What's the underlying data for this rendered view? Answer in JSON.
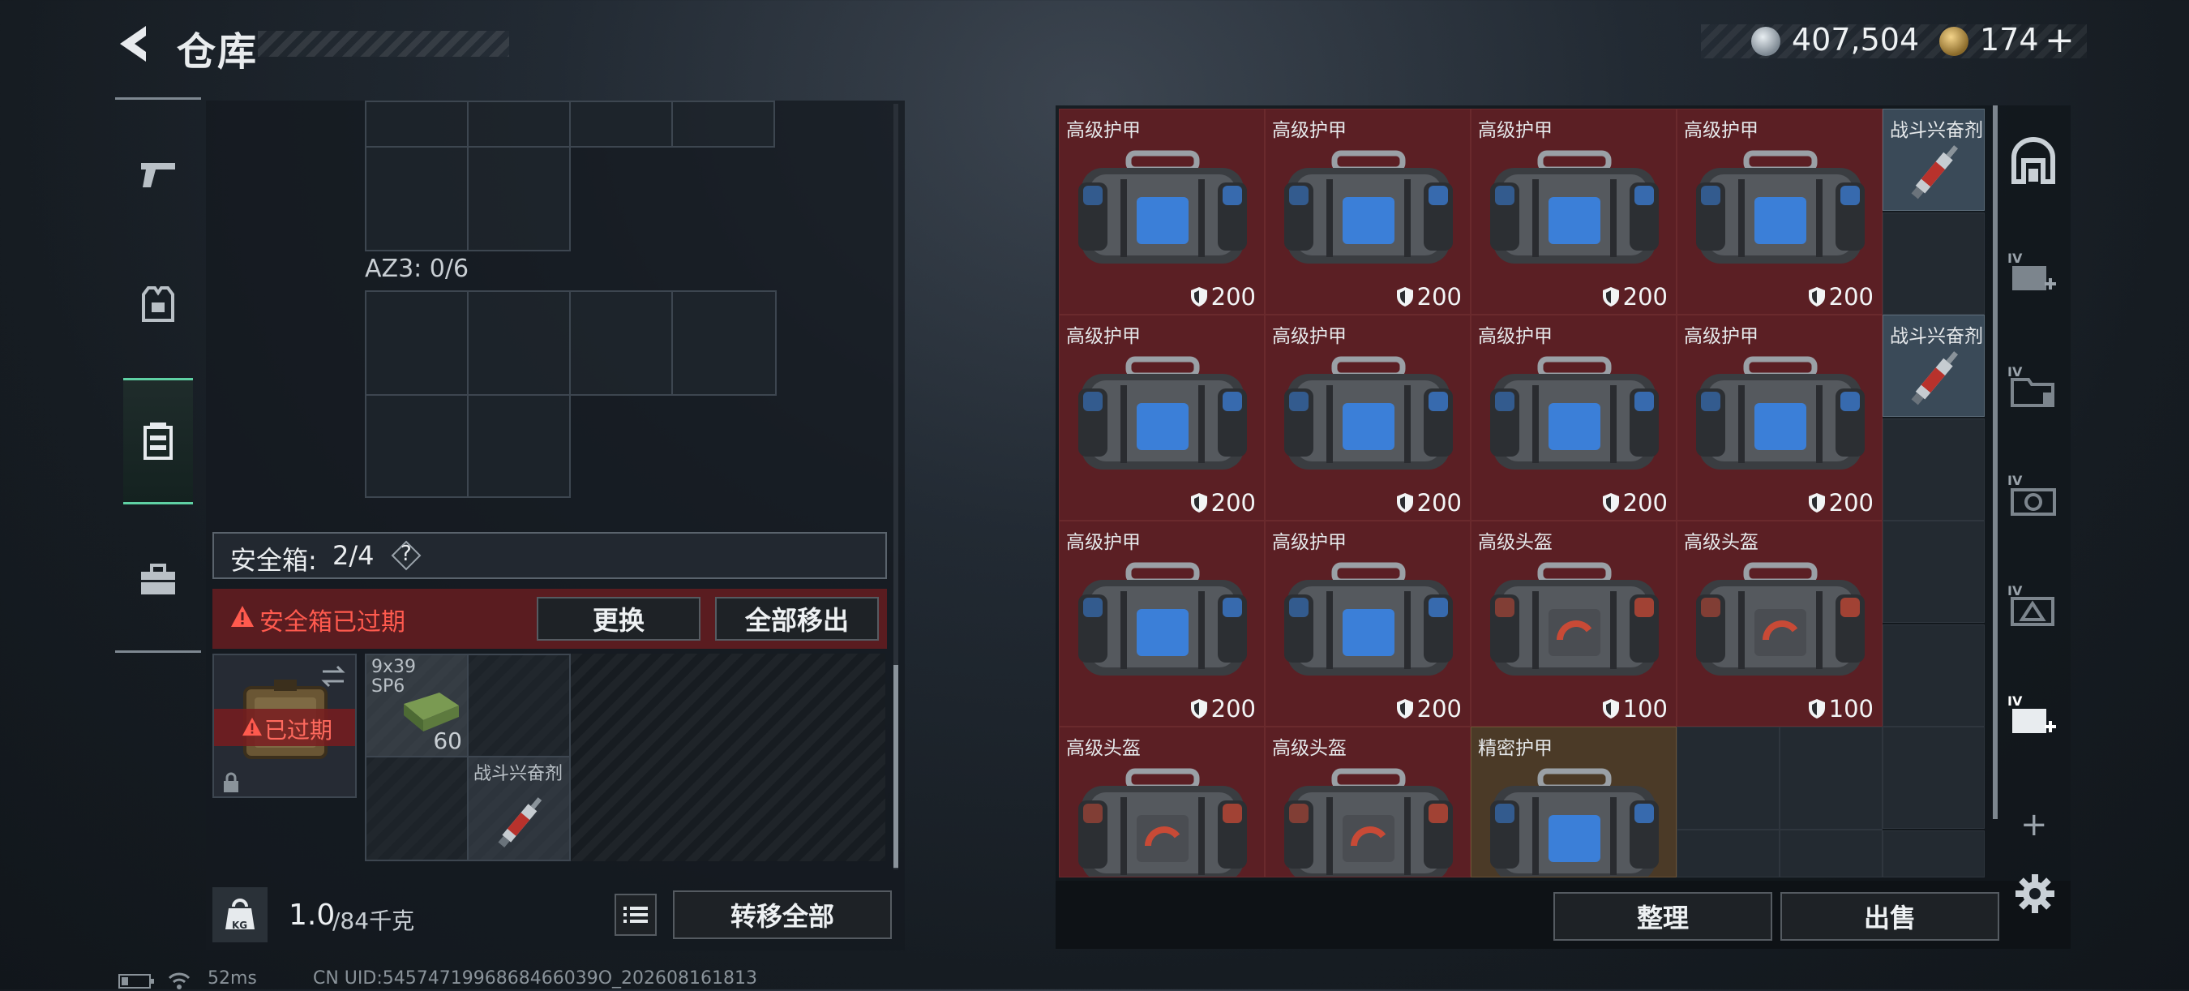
{
  "header": {
    "title": "仓库",
    "currency": {
      "coins": "407,504",
      "tokens": "174",
      "add_label": "+"
    }
  },
  "left_rail": {
    "items": [
      "weapon",
      "equipment",
      "safe-box",
      "case"
    ],
    "active": "safe-box"
  },
  "left_panel": {
    "az_label": "AZ3: 0/6",
    "safe_box": {
      "label": "安全箱:",
      "count": "2/4",
      "help": "?"
    },
    "expired_warning": "安全箱已过期",
    "replace_label": "更换",
    "move_all_out_label": "全部移出",
    "expired_badge": "已过期",
    "ammo": {
      "name": "9x39",
      "sub": "SP6",
      "count": "60"
    },
    "stim_name": "战斗兴奋剂"
  },
  "bottom_left": {
    "weight": "1.0",
    "weight_max": "/84千克",
    "kg_icon_label": "KG",
    "transfer_all_label": "转移全部"
  },
  "inventory": [
    {
      "name": "高级护甲",
      "value": "200",
      "kind": "armor"
    },
    {
      "name": "高级护甲",
      "value": "200",
      "kind": "armor"
    },
    {
      "name": "高级护甲",
      "value": "200",
      "kind": "armor"
    },
    {
      "name": "高级护甲",
      "value": "200",
      "kind": "armor"
    },
    {
      "name": "战斗兴奋剂",
      "value": "",
      "kind": "stim"
    },
    {
      "name": "高级护甲",
      "value": "200",
      "kind": "armor"
    },
    {
      "name": "高级护甲",
      "value": "200",
      "kind": "armor"
    },
    {
      "name": "高级护甲",
      "value": "200",
      "kind": "armor"
    },
    {
      "name": "高级护甲",
      "value": "200",
      "kind": "armor"
    },
    {
      "name": "战斗兴奋剂",
      "value": "",
      "kind": "stim"
    },
    {
      "name": "高级护甲",
      "value": "200",
      "kind": "armor"
    },
    {
      "name": "高级护甲",
      "value": "200",
      "kind": "armor"
    },
    {
      "name": "高级头盔",
      "value": "100",
      "kind": "helmet"
    },
    {
      "name": "高级头盔",
      "value": "100",
      "kind": "helmet"
    },
    {
      "name": "高级头盔",
      "value": "",
      "kind": "helmet"
    },
    {
      "name": "高级头盔",
      "value": "",
      "kind": "helmet"
    },
    {
      "name": "精密护甲",
      "value": "",
      "kind": "gold"
    }
  ],
  "right_bottom": {
    "sort_label": "整理",
    "sell_label": "出售",
    "add_label": "+"
  },
  "side_icons": [
    "home-arch",
    "storage-add-IV",
    "folder-IV",
    "camera-IV",
    "tag-IV",
    "storage-add-IV-active"
  ],
  "status_bar": {
    "ping": "52ms",
    "uid": "CN UID:5457471996868466039O_202608161813"
  }
}
